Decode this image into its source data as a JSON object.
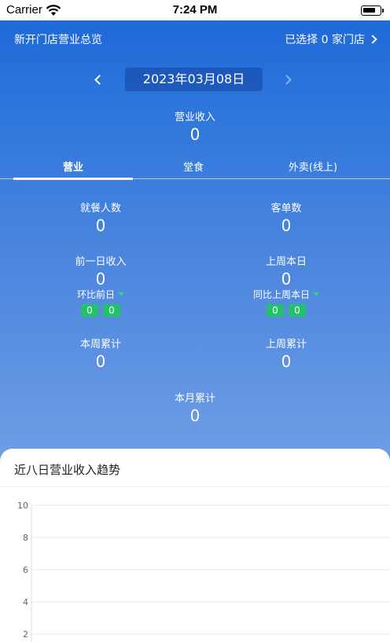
{
  "status_bar": {
    "carrier": "Carrier",
    "time": "7:24 PM"
  },
  "header": {
    "title": "新开门店营业总览",
    "store_selector": "已选择 0 家门店"
  },
  "date_nav": {
    "date": "2023年03月08日"
  },
  "revenue": {
    "label": "营业收入",
    "value": "0"
  },
  "tabs": [
    {
      "label": "营业",
      "active": true
    },
    {
      "label": "堂食",
      "active": false
    },
    {
      "label": "外卖(线上)",
      "active": false
    }
  ],
  "stats": {
    "diners": {
      "label": "就餐人数",
      "value": "0"
    },
    "avg_ticket": {
      "label": "客单数",
      "value": "0"
    },
    "prev_day": {
      "label": "前一日收入",
      "value": "0"
    },
    "last_week_day": {
      "label": "上周本日",
      "value": "0"
    },
    "dod": {
      "label": "环比前日",
      "badges": [
        "0",
        "0"
      ]
    },
    "wow": {
      "label": "同比上周本日",
      "badges": [
        "0",
        "0"
      ]
    },
    "week_total": {
      "label": "本周累计",
      "value": "0"
    },
    "last_week_total": {
      "label": "上周累计",
      "value": "0"
    },
    "month_total": {
      "label": "本月累计",
      "value": "0"
    }
  },
  "trend_card": {
    "title": "近八日营业收入趋势"
  },
  "chart_data": {
    "type": "line",
    "title": "近八日营业收入趋势",
    "x": [],
    "series": [],
    "ylim": [
      0,
      10
    ],
    "yticks": [
      2,
      4,
      6,
      8,
      10
    ],
    "grid": true
  },
  "colors": {
    "primary": "#1b67d8",
    "badge_green": "#22c26a"
  }
}
